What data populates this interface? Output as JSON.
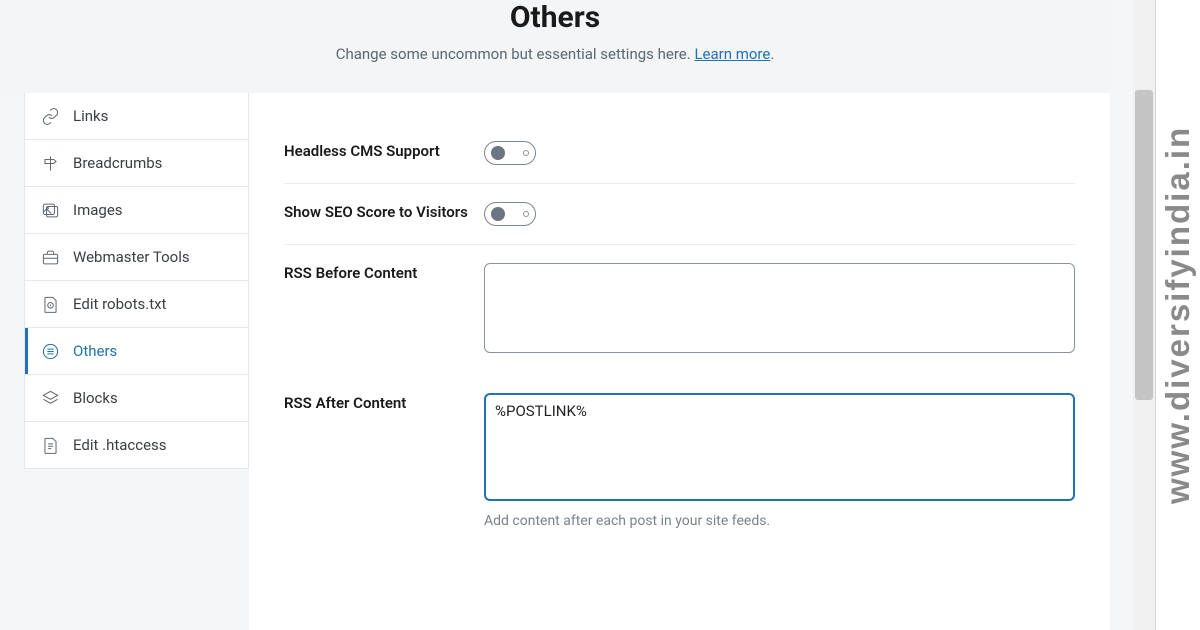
{
  "header": {
    "title": "Others",
    "subtitle": "Change some uncommon but essential settings here.",
    "learn_more": "Learn more"
  },
  "sidebar": {
    "items": [
      {
        "key": "links",
        "label": "Links"
      },
      {
        "key": "breadcrumbs",
        "label": "Breadcrumbs"
      },
      {
        "key": "images",
        "label": "Images"
      },
      {
        "key": "webmaster",
        "label": "Webmaster Tools"
      },
      {
        "key": "robots",
        "label": "Edit robots.txt"
      },
      {
        "key": "others",
        "label": "Others"
      },
      {
        "key": "blocks",
        "label": "Blocks"
      },
      {
        "key": "htaccess",
        "label": "Edit .htaccess"
      }
    ]
  },
  "form": {
    "headless_label": "Headless CMS Support",
    "seo_score_label": "Show SEO Score to Visitors",
    "rss_before_label": "RSS Before Content",
    "rss_before_value": "",
    "rss_after_label": "RSS After Content",
    "rss_after_value": "%POSTLINK%",
    "rss_after_help": "Add content after each post in your site feeds."
  },
  "watermark": "www.diversifyindia.in"
}
